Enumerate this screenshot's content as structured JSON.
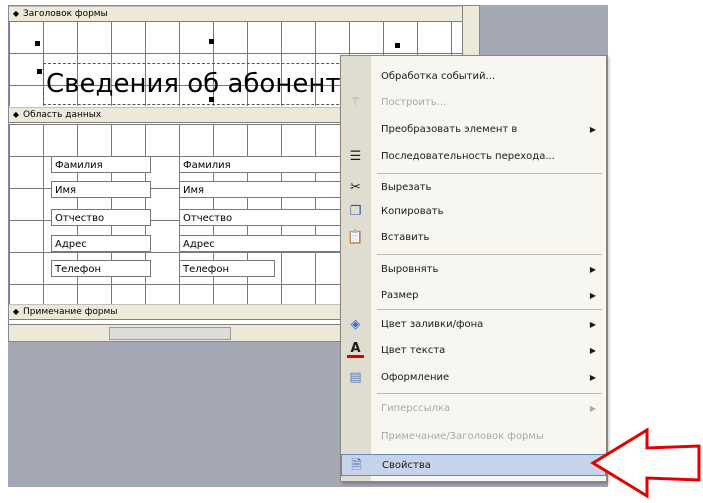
{
  "designer": {
    "header_band": "Заголовок формы",
    "detail_band": "Область данных",
    "footer_band": "Примечание формы",
    "title_label": "Сведения об абонента",
    "fields": [
      {
        "label": "Фамилия",
        "value": "Фамилия"
      },
      {
        "label": "Имя",
        "value": "Имя"
      },
      {
        "label": "Отчество",
        "value": "Отчество"
      },
      {
        "label": "Адрес",
        "value": "Адрес"
      },
      {
        "label": "Телефон",
        "value": "Телефон"
      }
    ]
  },
  "context_menu": {
    "items": [
      {
        "label": "Обработка событий...",
        "icon": "none",
        "enabled": true,
        "submenu": false
      },
      {
        "label": "Построить...",
        "icon": "magic-wand-icon",
        "enabled": false,
        "submenu": false
      },
      {
        "label": "Преобразовать элемент в",
        "icon": "none",
        "enabled": true,
        "submenu": true
      },
      {
        "label": "Последовательность перехода...",
        "icon": "tab-order-icon",
        "enabled": true,
        "submenu": false
      },
      {
        "label": "Вырезать",
        "icon": "scissors-icon",
        "enabled": true,
        "submenu": false
      },
      {
        "label": "Копировать",
        "icon": "copy-icon",
        "enabled": true,
        "submenu": false
      },
      {
        "label": "Вставить",
        "icon": "paste-icon",
        "enabled": true,
        "submenu": false
      },
      {
        "label": "Выровнять",
        "icon": "none",
        "enabled": true,
        "submenu": true
      },
      {
        "label": "Размер",
        "icon": "none",
        "enabled": true,
        "submenu": true
      },
      {
        "label": "Цвет заливки/фона",
        "icon": "fill-color-icon",
        "enabled": true,
        "submenu": true
      },
      {
        "label": "Цвет текста",
        "icon": "font-color-icon",
        "enabled": true,
        "submenu": true
      },
      {
        "label": "Оформление",
        "icon": "special-effect-icon",
        "enabled": true,
        "submenu": true
      },
      {
        "label": "Гиперссылка",
        "icon": "none",
        "enabled": false,
        "submenu": true
      },
      {
        "label": "Примечание/Заголовок формы",
        "icon": "none",
        "enabled": false,
        "submenu": false
      },
      {
        "label": "Свойства",
        "icon": "properties-icon",
        "enabled": true,
        "submenu": false,
        "highlighted": true
      }
    ]
  },
  "colors": {
    "arrow": "#e00000",
    "menu_highlight": "#c7d3ea",
    "desktop": "#a4a8b5"
  }
}
